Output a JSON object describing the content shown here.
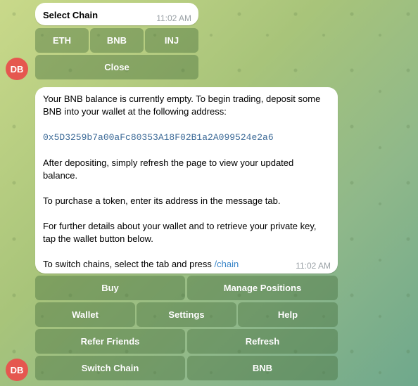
{
  "top_message": {
    "title": "Select Chain",
    "time": "11:02 AM",
    "buttons": [
      "ETH",
      "BNB",
      "INJ"
    ],
    "close_label": "Close"
  },
  "avatar_initials": "DB",
  "main_message": {
    "para1": "Your BNB balance is currently empty. To begin trading, deposit some BNB into your wallet at the following address:",
    "address": "0x5D3259b7a00aFc80353A18F02B1a2A099524e2a6",
    "para2": "After depositing, simply refresh the page to view your updated balance.",
    "para3": "To purchase a token, enter its address in the message tab.",
    "para4": "For further details about your wallet and to retrieve your private key, tap the wallet button below.",
    "para5_text": "To switch chains, select the tab and press ",
    "para5_link": "/chain",
    "time": "11:02 AM"
  },
  "keyboard": {
    "buy": "Buy",
    "manage_positions": "Manage Positions",
    "wallet": "Wallet",
    "settings": "Settings",
    "help": "Help",
    "refer_friends": "Refer Friends",
    "refresh": "Refresh",
    "switch_chain": "Switch Chain",
    "bnb": "BNB"
  }
}
